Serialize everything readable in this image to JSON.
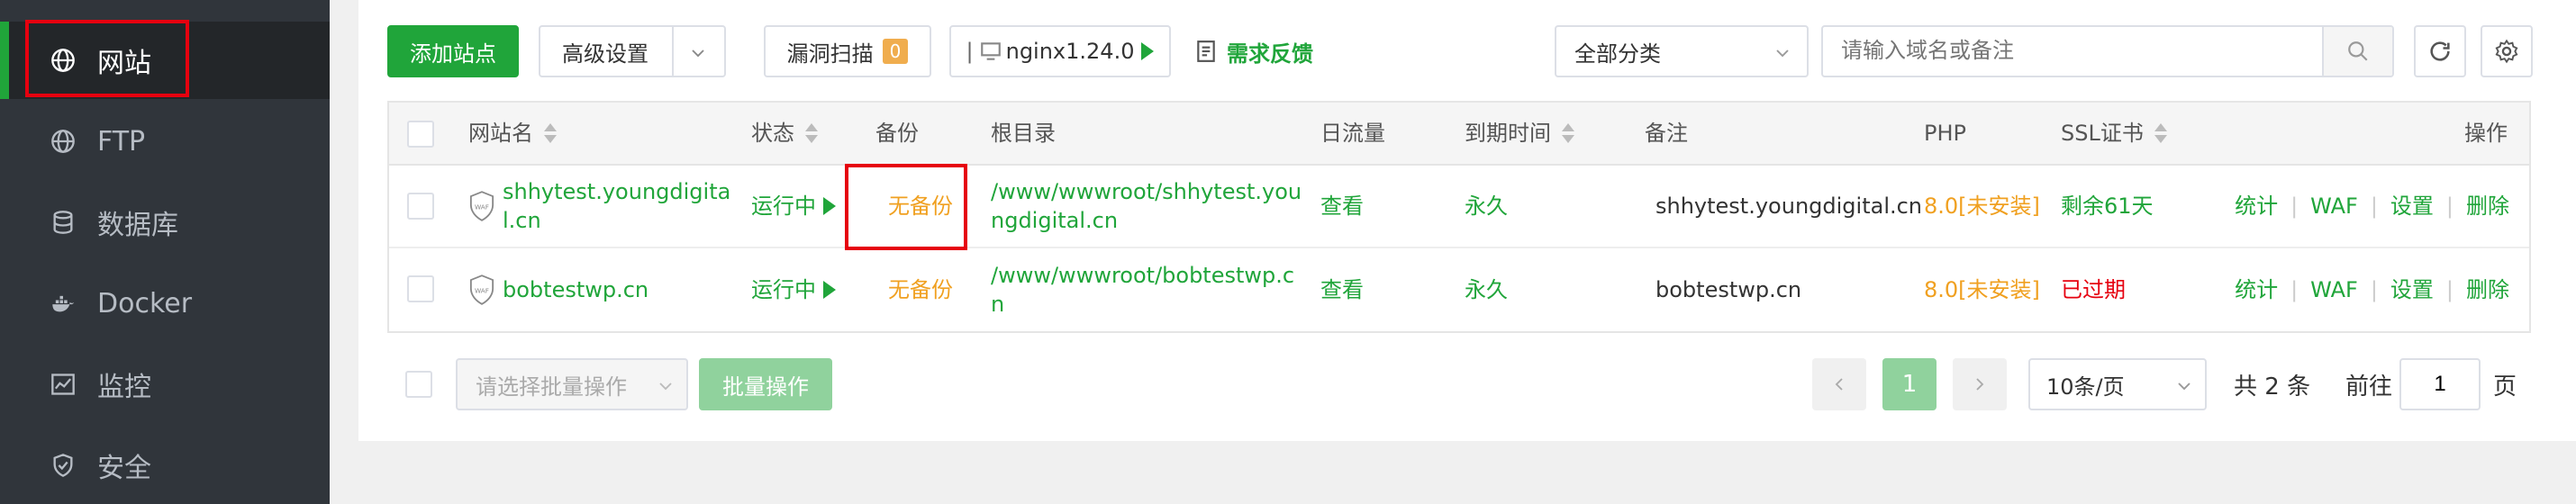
{
  "sidebar": {
    "items": [
      {
        "label": "网站",
        "icon": "globe-icon",
        "active": true
      },
      {
        "label": "FTP",
        "icon": "ftp-globe-icon",
        "active": false
      },
      {
        "label": "数据库",
        "icon": "database-icon",
        "active": false
      },
      {
        "label": "Docker",
        "icon": "docker-icon",
        "active": false
      },
      {
        "label": "监控",
        "icon": "monitor-chart-icon",
        "active": false
      },
      {
        "label": "安全",
        "icon": "shield-icon",
        "active": false
      }
    ]
  },
  "toolbar": {
    "add_site": "添加站点",
    "advanced_settings": "高级设置",
    "vuln_scan": "漏洞扫描",
    "vuln_count": "0",
    "nginx_version": "nginx1.24.0",
    "feedback": "需求反馈",
    "category_select": "全部分类",
    "search_placeholder": "请输入域名或备注"
  },
  "table": {
    "headers": {
      "name": "网站名",
      "status": "状态",
      "backup": "备份",
      "root": "根目录",
      "traffic": "日流量",
      "expire": "到期时间",
      "remark": "备注",
      "php": "PHP",
      "ssl": "SSL证书",
      "actions": "操作"
    },
    "rows": [
      {
        "name_line1": "shhytest.youngdigita",
        "name_line2": "l.cn",
        "status": "运行中",
        "backup": "无备份",
        "root_line1": "/www/wwwroot/shhytest.you",
        "root_line2": "ngdigital.cn",
        "traffic": "查看",
        "expire": "永久",
        "remark": "shhytest.youngdigital.cn",
        "php": "8.0[未安装]",
        "ssl": "剩余61天",
        "actions": [
          "统计",
          "WAF",
          "设置",
          "删除"
        ]
      },
      {
        "name_line1": "bobtestwp.cn",
        "name_line2": "",
        "status": "运行中",
        "backup": "无备份",
        "root_line1": "/www/wwwroot/bobtestwp.c",
        "root_line2": "n",
        "traffic": "查看",
        "expire": "永久",
        "remark": "bobtestwp.cn",
        "php": "8.0[未安装]",
        "ssl": "已过期",
        "actions": [
          "统计",
          "WAF",
          "设置",
          "删除"
        ]
      }
    ]
  },
  "footer": {
    "batch_select_placeholder": "请选择批量操作",
    "batch_button": "批量操作",
    "current_page": "1",
    "page_size": "10条/页",
    "total": "共 2 条",
    "goto_label": "前往",
    "goto_value": "1",
    "page_unit": "页"
  },
  "colors": {
    "accent": "#20a53a",
    "warning": "#f0a020",
    "danger": "#e6000f",
    "sidebar_bg": "#30353b"
  }
}
